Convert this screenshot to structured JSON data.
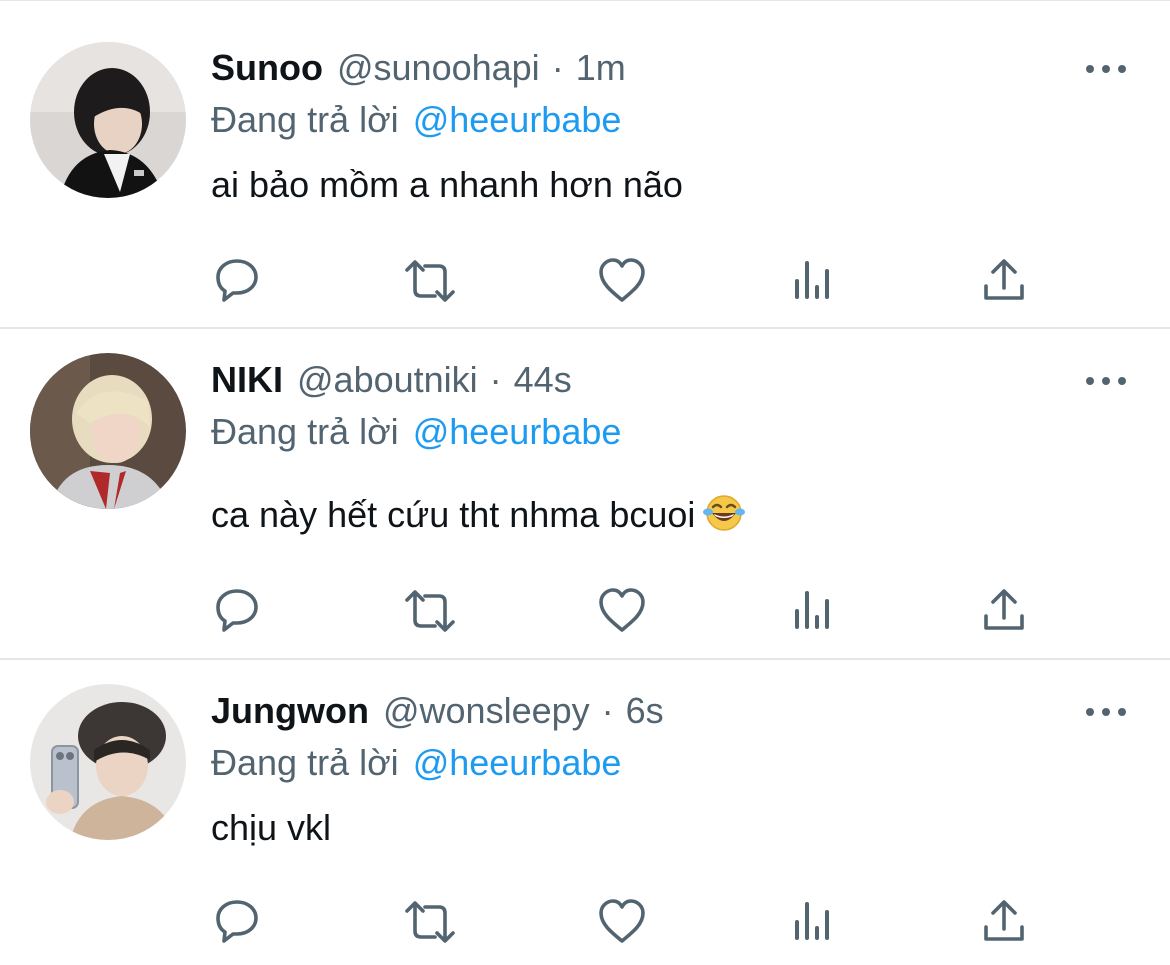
{
  "tweets": [
    {
      "display_name": "Sunoo",
      "handle": "@sunoohapi",
      "separator": "·",
      "time": "1m",
      "reply_prefix": "Đang trả lời",
      "reply_to": "@heeurbabe",
      "text": "ai bảo mồm a nhanh hơn não",
      "emoji": "",
      "avatar_icon": "avatar-photo",
      "actions": [
        "reply-icon",
        "retweet-icon",
        "like-icon",
        "analytics-icon",
        "share-icon"
      ]
    },
    {
      "display_name": "NIKI",
      "handle": "@aboutniki",
      "separator": "·",
      "time": "44s",
      "reply_prefix": "Đang trả lời",
      "reply_to": "@heeurbabe",
      "text": "ca này hết cứu tht nhma bcuoi",
      "emoji": "😂",
      "avatar_icon": "avatar-photo",
      "actions": [
        "reply-icon",
        "retweet-icon",
        "like-icon",
        "analytics-icon",
        "share-icon"
      ]
    },
    {
      "display_name": "Jungwon",
      "handle": "@wonsleepy",
      "separator": "·",
      "time": "6s",
      "reply_prefix": "Đang trả lời",
      "reply_to": "@heeurbabe",
      "text": "chịu vkl",
      "emoji": "",
      "avatar_icon": "avatar-photo",
      "actions": [
        "reply-icon",
        "retweet-icon",
        "like-icon",
        "analytics-icon",
        "share-icon"
      ]
    }
  ],
  "colors": {
    "text_primary": "#0f1419",
    "text_secondary": "#536471",
    "mention": "#1d9bf0",
    "divider": "#e4e6e8",
    "icon": "#536471"
  }
}
